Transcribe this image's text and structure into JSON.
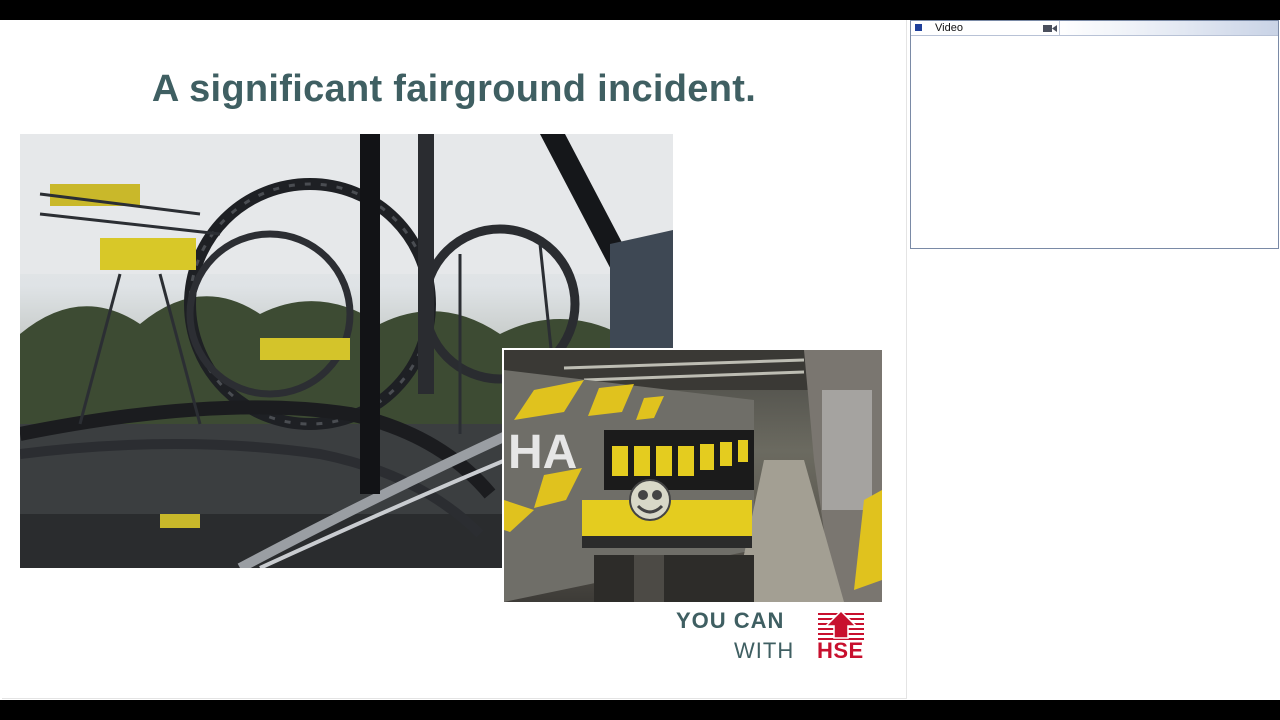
{
  "slide": {
    "title": "A significant fairground incident.",
    "logo": {
      "line1": "YOU CAN",
      "line2": "WITH",
      "brand": "HSE"
    }
  },
  "video_panel": {
    "title": "Video",
    "icon": "camera-icon"
  },
  "colors": {
    "title": "#3f5f62",
    "hse_red": "#c8102e",
    "panel_border": "#7a8aa6"
  }
}
